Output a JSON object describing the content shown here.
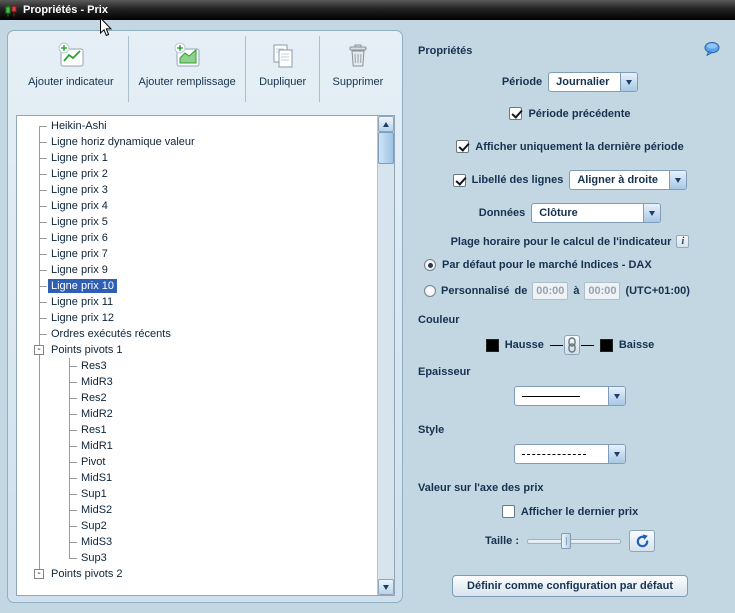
{
  "window": {
    "title": "Propriétés - Prix"
  },
  "toolbar": {
    "buttons": [
      {
        "id": "add-indicator",
        "label": "Ajouter indicateur",
        "icon": "add-indicator-icon"
      },
      {
        "id": "add-fill",
        "label": "Ajouter remplissage",
        "icon": "add-fill-icon"
      },
      {
        "id": "duplicate",
        "label": "Dupliquer",
        "icon": "duplicate-icon"
      },
      {
        "id": "delete",
        "label": "Supprimer",
        "icon": "trash-icon"
      }
    ]
  },
  "tree": {
    "items": [
      {
        "label": "Heikin-Ashi"
      },
      {
        "label": "Ligne horiz dynamique valeur"
      },
      {
        "label": "Ligne prix 1"
      },
      {
        "label": "Ligne prix 2"
      },
      {
        "label": "Ligne prix 3"
      },
      {
        "label": "Ligne prix 4"
      },
      {
        "label": "Ligne prix 5"
      },
      {
        "label": "Ligne prix 6"
      },
      {
        "label": "Ligne prix 7"
      },
      {
        "label": "Ligne prix 9"
      },
      {
        "label": "Ligne prix 10",
        "selected": true
      },
      {
        "label": "Ligne prix 11"
      },
      {
        "label": "Ligne prix 12"
      },
      {
        "label": "Ordres exécutés récents"
      },
      {
        "label": "Points pivots 1",
        "expandable": true
      },
      {
        "label": "Res3",
        "level": 1
      },
      {
        "label": "MidR3",
        "level": 1
      },
      {
        "label": "Res2",
        "level": 1
      },
      {
        "label": "MidR2",
        "level": 1
      },
      {
        "label": "Res1",
        "level": 1
      },
      {
        "label": "MidR1",
        "level": 1
      },
      {
        "label": "Pivot",
        "level": 1
      },
      {
        "label": "MidS1",
        "level": 1
      },
      {
        "label": "Sup1",
        "level": 1
      },
      {
        "label": "MidS2",
        "level": 1
      },
      {
        "label": "Sup2",
        "level": 1
      },
      {
        "label": "MidS3",
        "level": 1
      },
      {
        "label": "Sup3",
        "level": 1
      },
      {
        "label": "Points pivots 2",
        "expandable": true
      }
    ]
  },
  "properties": {
    "title": "Propriétés",
    "periode_label": "Période",
    "periode_value": "Journalier",
    "periode_precedente_label": "Période précédente",
    "afficher_derniere_label": "Afficher uniquement la dernière période",
    "libelle_lignes_label": "Libellé des lignes",
    "libelle_value": "Aligner à droite",
    "donnees_label": "Données",
    "donnees_value": "Clôture",
    "plage_title": "Plage horaire pour le calcul de l'indicateur",
    "radio_default_label": "Par défaut pour le marché Indices - DAX",
    "radio_custom_label": "Personnalisé",
    "de_label": "de",
    "a_label": "à",
    "time_from": "00:00",
    "time_to": "00:00",
    "utc_label": "(UTC+01:00)",
    "couleur_label": "Couleur",
    "hausse_label": "Hausse",
    "baisse_label": "Baisse",
    "epaisseur_label": "Epaisseur",
    "style_label": "Style",
    "valeur_axe_label": "Valeur sur l'axe des prix",
    "afficher_dernier_prix_label": "Afficher le dernier prix",
    "taille_label": "Taille :",
    "default_button_label": "Définir comme configuration par défaut"
  },
  "colors": {
    "selection": "#2e5fb3",
    "hausse": "#000000",
    "baisse": "#000000",
    "bubble": "#5aa3ec",
    "reset_arrow": "#1e5fc2"
  }
}
